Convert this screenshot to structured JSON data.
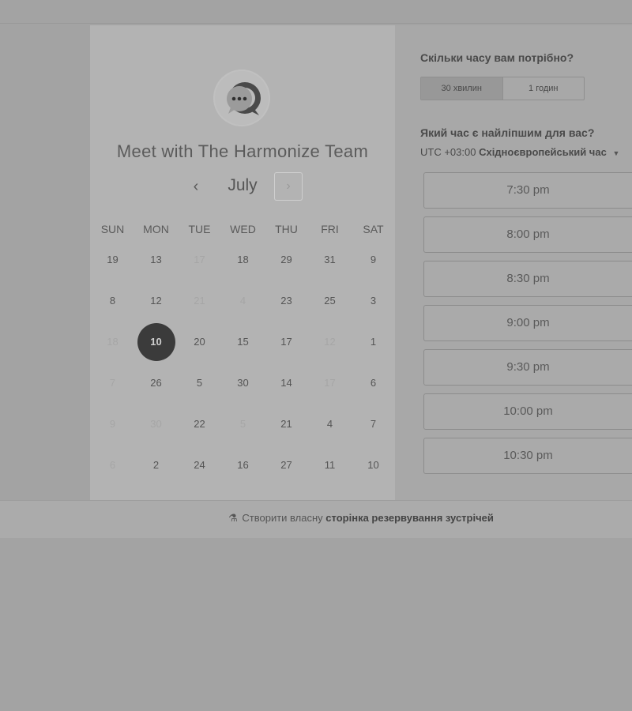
{
  "header": {
    "title": "Meet with The Harmonize Team"
  },
  "calendar": {
    "month": "July",
    "prev_icon": "chevron-left-icon",
    "next_icon": "chevron-right-icon",
    "weekdays": [
      "SUN",
      "MON",
      "TUE",
      "WED",
      "THU",
      "FRI",
      "SAT"
    ],
    "weeks": [
      [
        {
          "d": "19"
        },
        {
          "d": "13"
        },
        {
          "d": "17",
          "disabled": true
        },
        {
          "d": "18"
        },
        {
          "d": "29"
        },
        {
          "d": "31"
        },
        {
          "d": "9"
        }
      ],
      [
        {
          "d": "8"
        },
        {
          "d": "12"
        },
        {
          "d": "21",
          "disabled": true
        },
        {
          "d": "4",
          "disabled": true
        },
        {
          "d": "23"
        },
        {
          "d": "25"
        },
        {
          "d": "3"
        }
      ],
      [
        {
          "d": "18",
          "disabled": true
        },
        {
          "d": "10",
          "selected": true
        },
        {
          "d": "20"
        },
        {
          "d": "15"
        },
        {
          "d": "17"
        },
        {
          "d": "12",
          "disabled": true
        },
        {
          "d": "1"
        }
      ],
      [
        {
          "d": "7",
          "disabled": true
        },
        {
          "d": "26"
        },
        {
          "d": "5"
        },
        {
          "d": "30"
        },
        {
          "d": "14"
        },
        {
          "d": "17",
          "disabled": true
        },
        {
          "d": "6"
        }
      ],
      [
        {
          "d": "9",
          "disabled": true
        },
        {
          "d": "30",
          "disabled": true
        },
        {
          "d": "22"
        },
        {
          "d": "5",
          "disabled": true
        },
        {
          "d": "21"
        },
        {
          "d": "4"
        },
        {
          "d": "7"
        }
      ],
      [
        {
          "d": "6",
          "disabled": true
        },
        {
          "d": "2"
        },
        {
          "d": "24"
        },
        {
          "d": "16"
        },
        {
          "d": "27"
        },
        {
          "d": "11"
        },
        {
          "d": "10"
        }
      ]
    ]
  },
  "duration": {
    "question": "Скільки часу вам потрібно?",
    "options": [
      "30 хвилин",
      "1 годин"
    ],
    "selected": "30 хвилин"
  },
  "time": {
    "question": "Який час є найліпшим для вас?",
    "tz_offset": "UTC +03:00",
    "tz_name": "Східноєвропейський час",
    "slots": [
      "7:30 pm",
      "8:00 pm",
      "8:30 pm",
      "9:00 pm",
      "9:30 pm",
      "10:00 pm",
      "10:30 pm"
    ]
  },
  "footer": {
    "prefix": "Створити власну",
    "bold": "сторінка резервування зустрічей"
  },
  "colors": {
    "selected_day_bg": "#3b3b3b",
    "page_bg": "#a3a3a3"
  }
}
